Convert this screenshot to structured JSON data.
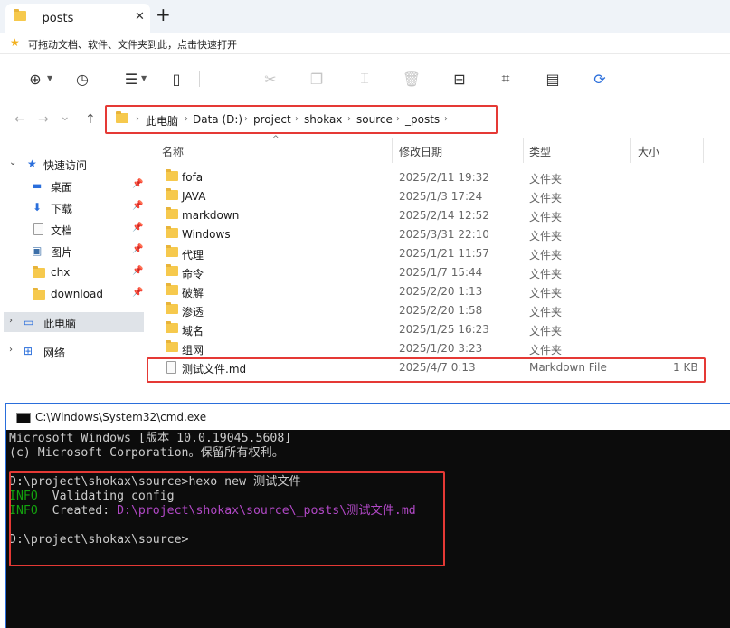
{
  "tab": {
    "title": "_posts",
    "close": "✕",
    "add": "+"
  },
  "hint": {
    "text": "可拖动文档、软件、文件夹到此，点击快速打开"
  },
  "toolbar": {
    "buttons": [
      {
        "name": "new-icon",
        "glyph": "⊕"
      },
      {
        "name": "clock-icon",
        "glyph": "◷"
      },
      {
        "name": "menu-icon",
        "glyph": "☰"
      },
      {
        "name": "layout-icon",
        "glyph": "▯"
      },
      {
        "name": "cut-icon",
        "glyph": "✂"
      },
      {
        "name": "copy-icon",
        "glyph": "❐"
      },
      {
        "name": "rename-icon",
        "glyph": "⌶"
      },
      {
        "name": "delete-icon",
        "glyph": "🗑"
      },
      {
        "name": "share-icon",
        "glyph": "⊟"
      },
      {
        "name": "crop-icon",
        "glyph": "⌗"
      },
      {
        "name": "compress-icon",
        "glyph": "▤"
      },
      {
        "name": "refresh-icon",
        "glyph": "⟳"
      }
    ]
  },
  "nav": {
    "back": "←",
    "forward": "→",
    "recent": "⌄",
    "up": "↑"
  },
  "address": {
    "crumbs": [
      "此电脑",
      "Data (D:)",
      "project",
      "shokax",
      "source",
      "_posts"
    ],
    "sep": "›"
  },
  "sidebar": {
    "quick_access": "快速访问",
    "items": [
      {
        "label": "桌面",
        "icon": "desktop-icon"
      },
      {
        "label": "下载",
        "icon": "download-icon"
      },
      {
        "label": "文档",
        "icon": "document-icon"
      },
      {
        "label": "图片",
        "icon": "picture-icon"
      },
      {
        "label": "chx",
        "icon": "folder-icon"
      },
      {
        "label": "download",
        "icon": "folder-icon"
      }
    ],
    "this_pc": "此电脑",
    "network": "网络"
  },
  "columns": {
    "name": "名称",
    "date": "修改日期",
    "type": "类型",
    "size": "大小"
  },
  "files": [
    {
      "name": "fofa",
      "date": "2025/2/11 19:32",
      "type": "文件夹",
      "size": "",
      "kind": "folder"
    },
    {
      "name": "JAVA",
      "date": "2025/1/3 17:24",
      "type": "文件夹",
      "size": "",
      "kind": "folder"
    },
    {
      "name": "markdown",
      "date": "2025/2/14 12:52",
      "type": "文件夹",
      "size": "",
      "kind": "folder"
    },
    {
      "name": "Windows",
      "date": "2025/3/31 22:10",
      "type": "文件夹",
      "size": "",
      "kind": "folder"
    },
    {
      "name": "代理",
      "date": "2025/1/21 11:57",
      "type": "文件夹",
      "size": "",
      "kind": "folder"
    },
    {
      "name": "命令",
      "date": "2025/1/7 15:44",
      "type": "文件夹",
      "size": "",
      "kind": "folder"
    },
    {
      "name": "破解",
      "date": "2025/2/20 1:13",
      "type": "文件夹",
      "size": "",
      "kind": "folder"
    },
    {
      "name": "渗透",
      "date": "2025/2/20 1:58",
      "type": "文件夹",
      "size": "",
      "kind": "folder"
    },
    {
      "name": "域名",
      "date": "2025/1/25 16:23",
      "type": "文件夹",
      "size": "",
      "kind": "folder"
    },
    {
      "name": "组网",
      "date": "2025/1/20 3:23",
      "type": "文件夹",
      "size": "",
      "kind": "folder"
    },
    {
      "name": "测试文件.md",
      "date": "2025/4/7 0:13",
      "type": "Markdown File",
      "size": "1 KB",
      "kind": "file"
    }
  ],
  "cmd": {
    "title": "C:\\Windows\\System32\\cmd.exe",
    "line1": "Microsoft Windows [版本 10.0.19045.5608]",
    "line2": "(c) Microsoft Corporation。保留所有权利。",
    "line3": "D:\\project\\shokax\\source>hexo new 测试文件",
    "info_tag": "INFO",
    "line4_msg": "  Validating config",
    "line5_msg": "  Created: ",
    "created_path": "D:\\project\\shokax\\source\\_posts\\测试文件.md",
    "line6": "D:\\project\\shokax\\source>"
  },
  "colors": {
    "highlight": "#e53935",
    "folder": "#f6c94d",
    "info": "#13a10e",
    "path": "#b148c6"
  }
}
